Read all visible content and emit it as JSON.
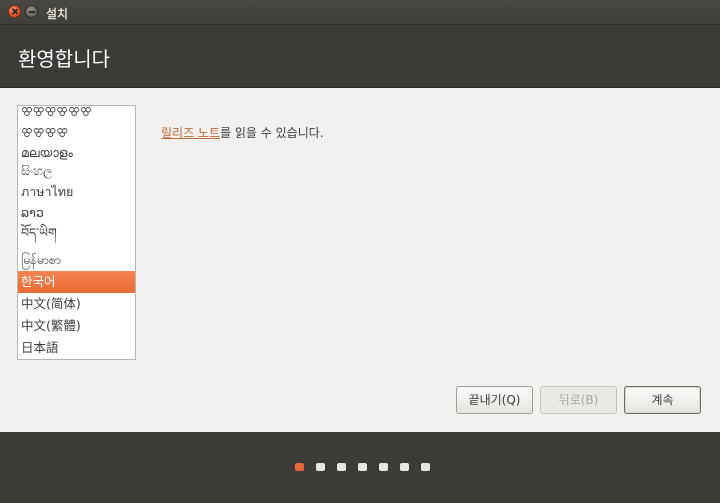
{
  "window": {
    "title": "설치"
  },
  "header": {
    "title": "환영합니다"
  },
  "language_list": {
    "items": [
      {
        "label": "ꕢꕢꕢꕢꕢꕢ"
      },
      {
        "label": "ꕢꕢꕢꕢ"
      },
      {
        "label": "മലയാളം"
      },
      {
        "label": "සිංහල"
      },
      {
        "label": "ภาษาไทย"
      },
      {
        "label": "ລາວ"
      },
      {
        "label": "བོད་ཡིག"
      },
      {
        "label": "မြန်မာစာ"
      },
      {
        "label": "한국어",
        "selected": true
      },
      {
        "label": "中文(简体)"
      },
      {
        "label": "中文(繁體)"
      },
      {
        "label": "日本語"
      }
    ]
  },
  "release_notes": {
    "link_text": "릴리즈 노트",
    "suffix_text": "를 읽을 수 있습니다."
  },
  "buttons": {
    "quit": "끝내기(Q)",
    "back": "뒤로(B)",
    "continue": "계속"
  },
  "progress": {
    "total_steps": 7,
    "current_step": 1,
    "accent_color": "#e6683c"
  }
}
